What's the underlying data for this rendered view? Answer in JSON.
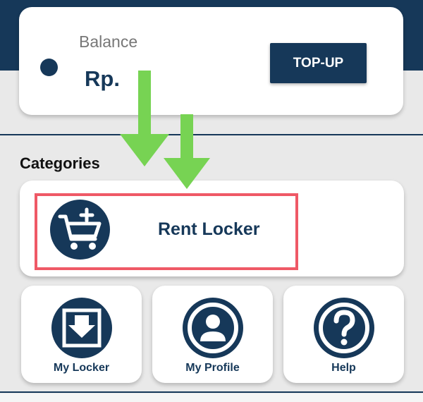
{
  "header": {
    "balance_label": "Balance",
    "balance_amount": "Rp.",
    "topup_label": "TOP-UP"
  },
  "categories": {
    "title": "Categories",
    "rent_locker_label": "Rent Locker",
    "tiles": [
      {
        "label": "My Locker",
        "icon": "locker-download-icon"
      },
      {
        "label": "My Profile",
        "icon": "user-profile-icon"
      },
      {
        "label": "Help",
        "icon": "help-question-icon"
      }
    ]
  },
  "annotations": {
    "arrow_color": "#77d353",
    "highlight_color": "#ef5966"
  },
  "theme": {
    "primary": "#163859",
    "background": "#e9e9e9",
    "card": "#ffffff"
  }
}
